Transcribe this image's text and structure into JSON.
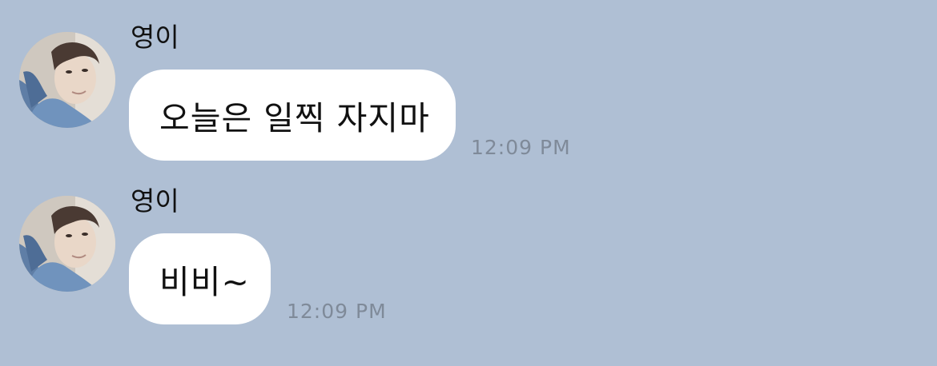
{
  "colors": {
    "background": "#afbfd4",
    "bubble": "#ffffff",
    "timestamp": "#7f8a99"
  },
  "messages": [
    {
      "sender": "영이",
      "avatar_icon": "profile-photo",
      "text": "오늘은 일찍 자지마",
      "time": "12:09 PM"
    },
    {
      "sender": "영이",
      "avatar_icon": "profile-photo",
      "text": "비비~",
      "time": "12:09 PM"
    }
  ]
}
